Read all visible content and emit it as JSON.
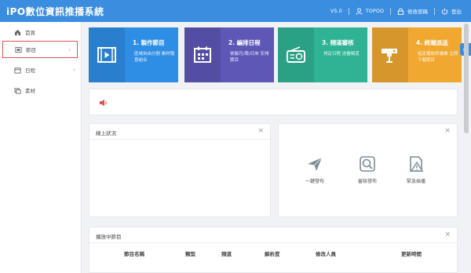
{
  "app": {
    "title": "iPO數位資訊推播系統",
    "version": "V5.0",
    "user": "TOPOO",
    "change_password": "修改密碼",
    "logout": "登出"
  },
  "sidebar": {
    "items": [
      {
        "label": "首頁",
        "icon": "home-icon"
      },
      {
        "label": "節目",
        "icon": "program-icon"
      },
      {
        "label": "日程",
        "icon": "calendar-icon"
      },
      {
        "label": "素材",
        "icon": "material-icon"
      }
    ]
  },
  "cards": [
    {
      "title": "1. 製作節目",
      "desc": "區域自由分割 素材隨意組合",
      "color": "#2e8ee6",
      "icon": "video-icon"
    },
    {
      "title": "2. 編排日程",
      "desc": "依據月/周/日來 安排節目",
      "color": "#5d57b6",
      "icon": "schedule-icon"
    },
    {
      "title": "3. 頻道審核",
      "desc": "排定日程 送審頻道",
      "color": "#2fb394",
      "icon": "radio-icon"
    },
    {
      "title": "4. 終端派送",
      "desc": "指定播放終端機 立即下載節目",
      "color": "#f0a830",
      "icon": "projector-icon"
    }
  ],
  "panels": {
    "online_status": {
      "title": "線上狀況"
    },
    "playing": {
      "title": "播放中節目"
    }
  },
  "actions": [
    {
      "label": "一鍵發布",
      "icon": "paper-plane-icon"
    },
    {
      "label": "審核發布",
      "icon": "review-icon"
    },
    {
      "label": "緊急插播",
      "icon": "emergency-icon"
    }
  ],
  "table": {
    "columns": [
      "節目名稱",
      "類型",
      "頻道",
      "解析度",
      "修改人員",
      "更新時間"
    ]
  }
}
